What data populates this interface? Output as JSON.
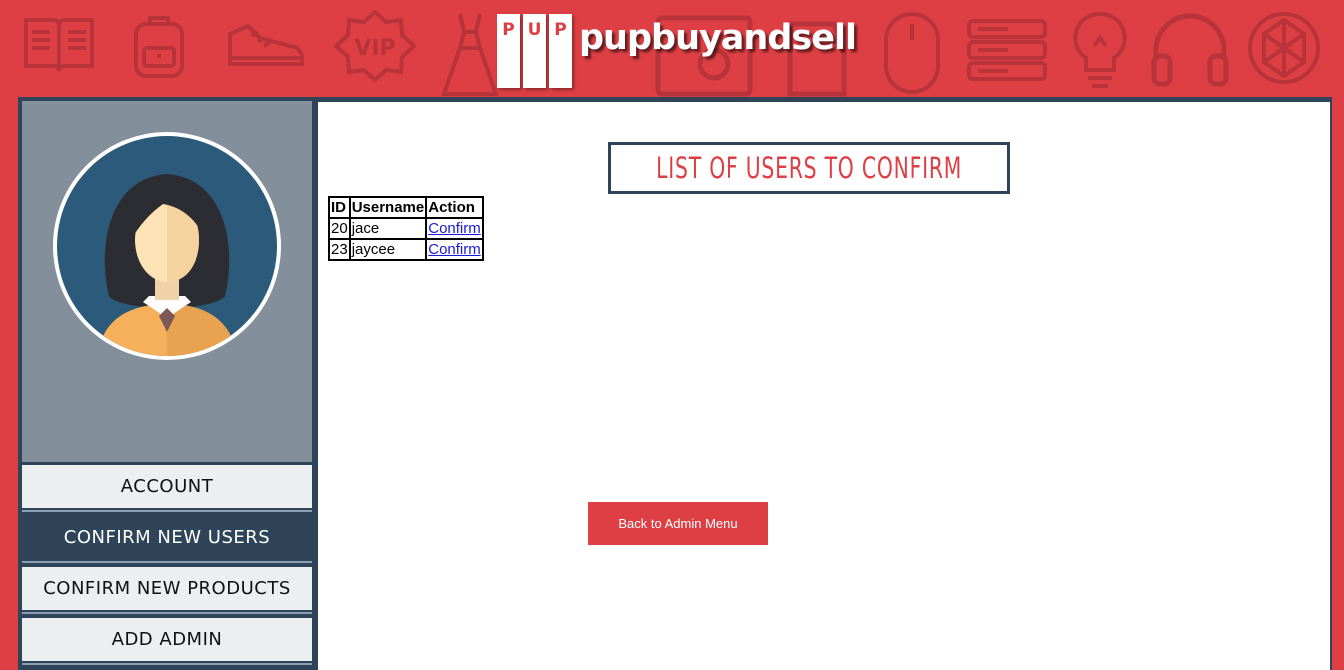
{
  "header": {
    "logo_letters": [
      "P",
      "U",
      "P"
    ],
    "logo_text": "pupbuyandsell",
    "background_icons": [
      "book-icon",
      "backpack-icon",
      "sneaker-icon",
      "vip-badge-icon",
      "dress-icon",
      "clipboard-icon",
      "laptop-icon",
      "mouse-icon",
      "server-icon",
      "lightbulb-icon",
      "headphones-icon",
      "gem-icon"
    ]
  },
  "sidebar": {
    "items": [
      {
        "label": "ACCOUNT",
        "active": false
      },
      {
        "label": "CONFIRM NEW USERS",
        "active": true
      },
      {
        "label": "CONFIRM NEW PRODUCTS",
        "active": false
      },
      {
        "label": "ADD ADMIN",
        "active": false
      }
    ]
  },
  "main": {
    "title": "LIST OF USERS TO CONFIRM",
    "table": {
      "headers": [
        "ID",
        "Username",
        "Action"
      ],
      "rows": [
        {
          "id": "20",
          "username": "jace",
          "action": "Confirm"
        },
        {
          "id": "23",
          "username": "jaycee",
          "action": "Confirm"
        }
      ]
    },
    "back_button": "Back to Admin Menu"
  },
  "colors": {
    "brand_red": "#dd3f44",
    "navy": "#2f4459",
    "profile_gray": "#838f9b",
    "link_blue": "#1a1ad6"
  }
}
